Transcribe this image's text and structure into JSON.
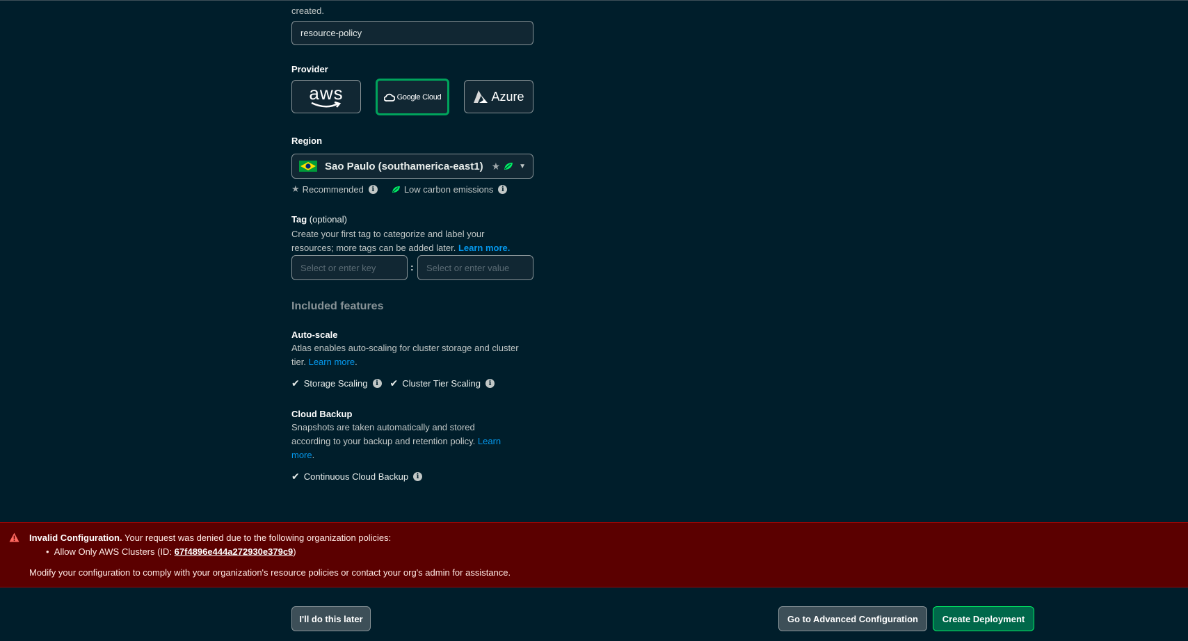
{
  "name_field": {
    "help_tail": "created.",
    "value": "resource-policy"
  },
  "provider": {
    "label": "Provider",
    "options": [
      {
        "name": "aws",
        "selected": false
      },
      {
        "name": "Google Cloud",
        "selected": true
      },
      {
        "name": "Azure",
        "selected": false
      }
    ]
  },
  "region": {
    "label": "Region",
    "selected": "Sao Paulo (southamerica-east1)",
    "legend": {
      "recommended": "Recommended",
      "low_carbon": "Low carbon emissions"
    }
  },
  "tag": {
    "label": "Tag",
    "optional": "(optional)",
    "description": "Create your first tag to categorize and label your resources; more tags can be added later.",
    "learn_more": "Learn more.",
    "key_placeholder": "Select or enter key",
    "separator": ":",
    "value_placeholder": "Select or enter value"
  },
  "included": {
    "heading": "Included features",
    "autoscale": {
      "title": "Auto-scale",
      "description": "Atlas enables auto-scaling for cluster storage and cluster tier.",
      "learn_more": "Learn more",
      "period": ".",
      "features": [
        "Storage Scaling",
        "Cluster Tier Scaling"
      ]
    },
    "backup": {
      "title": "Cloud Backup",
      "description": "Snapshots are taken automatically and stored according to your backup and retention policy.",
      "learn_more": "Learn more",
      "period": ".",
      "features": [
        "Continuous Cloud Backup"
      ]
    }
  },
  "error_banner": {
    "title": "Invalid Configuration.",
    "message": "Your request was denied due to the following organization policies:",
    "policy_prefix": "Allow Only AWS Clusters (ID: ",
    "policy_id": "67f4896e444a272930e379c9",
    "policy_suffix": ")",
    "footer": "Modify your configuration to comply with your organization's resource policies or contact your org's admin for assistance."
  },
  "actions": {
    "later": "I'll do this later",
    "advanced": "Go to Advanced Configuration",
    "create": "Create Deployment"
  },
  "colors": {
    "background": "#001e2b",
    "accent_green": "#00a35c",
    "link_blue": "#0498ec",
    "error_red": "#5b0000"
  }
}
